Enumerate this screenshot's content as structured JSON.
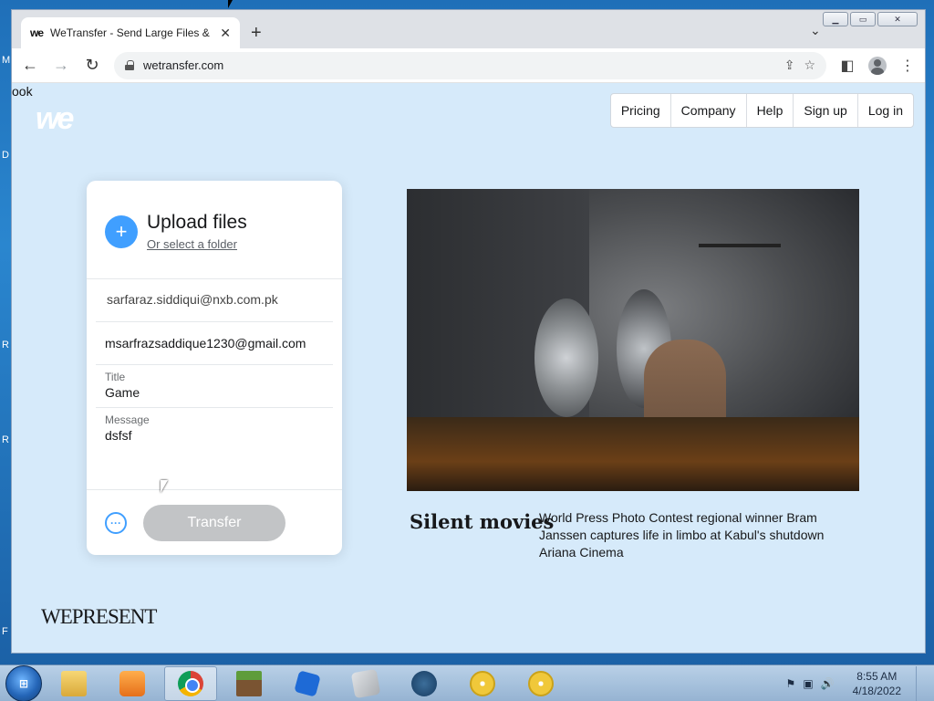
{
  "desktop": {
    "frags": [
      "M",
      "D",
      "R",
      "R",
      "F"
    ]
  },
  "browser": {
    "tab": {
      "favicon": "we",
      "title": "WeTransfer - Send Large Files & S",
      "close": "✕"
    },
    "newtab": "+",
    "tab_menu": "⌄",
    "window_controls": {
      "minimize": "▁",
      "maximize": "▭",
      "close": "✕"
    },
    "toolbar": {
      "back": "←",
      "forward": "→",
      "reload": "↻",
      "url": "wetransfer.com",
      "share_icon": "⇪",
      "star_icon": "☆",
      "sidepanel_icon": "◧",
      "menu_icon": "⋮"
    }
  },
  "page": {
    "left_frag": "ook",
    "logo": "we",
    "nav": [
      "Pricing",
      "Company",
      "Help",
      "Sign up",
      "Log in"
    ],
    "upload": {
      "plus": "+",
      "title": "Upload files",
      "folder_link": "Or select a folder",
      "email_to": "sarfaraz.siddiqui@nxb.com.pk",
      "email_from": "msarfrazsaddique1230@gmail.com",
      "title_label": "Title",
      "title_value": "Game",
      "message_label": "Message",
      "message_value": "dsfsf",
      "more": "···",
      "transfer": "Transfer"
    },
    "feature": {
      "title": "Silent movies",
      "text": "World Press Photo Contest regional winner Bram Janssen captures life in limbo at Kabul's shutdown Ariana Cinema"
    },
    "wepresent": "WEPRESENT"
  },
  "taskbar": {
    "start": "⊞",
    "tray_icons": [
      "⚑",
      "▣",
      "🔊"
    ],
    "time": "8:55 AM",
    "date": "4/18/2022"
  }
}
